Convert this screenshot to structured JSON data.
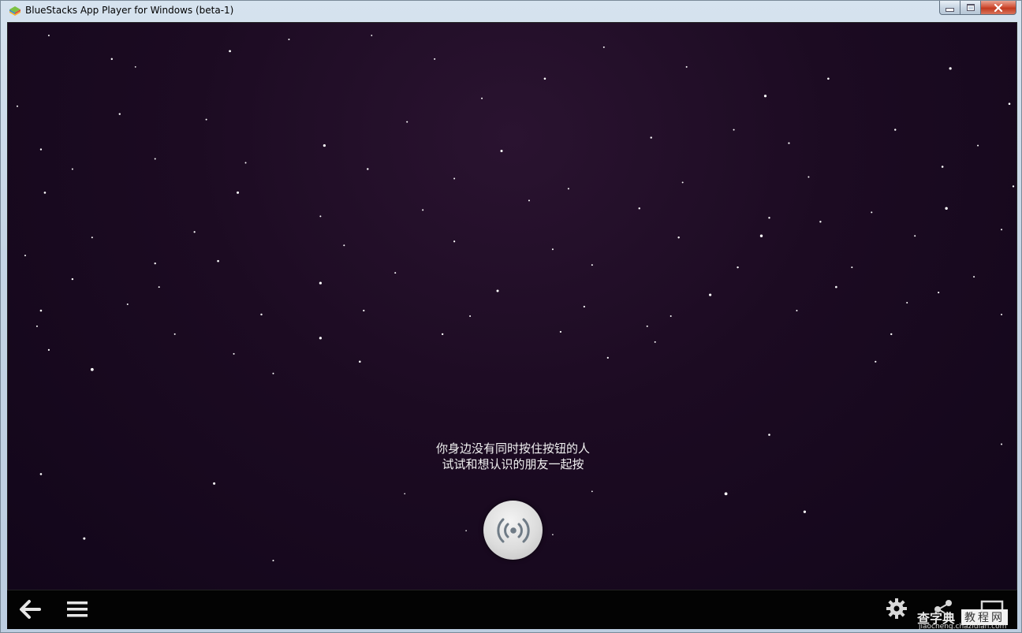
{
  "window": {
    "title": "BlueStacks App Player for Windows (beta-1)",
    "controls": [
      "minimize",
      "maximize",
      "close"
    ]
  },
  "app": {
    "message_line1": "你身边没有同时按住按钮的人",
    "message_line2": "试试和想认识的朋友一起按",
    "main_button_icon": "broadcast-signal-icon"
  },
  "navbar": {
    "left_icons": [
      "back-arrow-icon",
      "menu-icon"
    ],
    "right_icons": [
      "settings-gear-icon",
      "share-icon",
      "screen-icon"
    ]
  },
  "watermark": {
    "main": "查字典",
    "box": "教程网",
    "sub": "jiaocheng.chazidian.com"
  },
  "colors": {
    "screen_background": "#1c0b22",
    "navbar_background": "#030303",
    "close_button": "#c23a20"
  }
}
